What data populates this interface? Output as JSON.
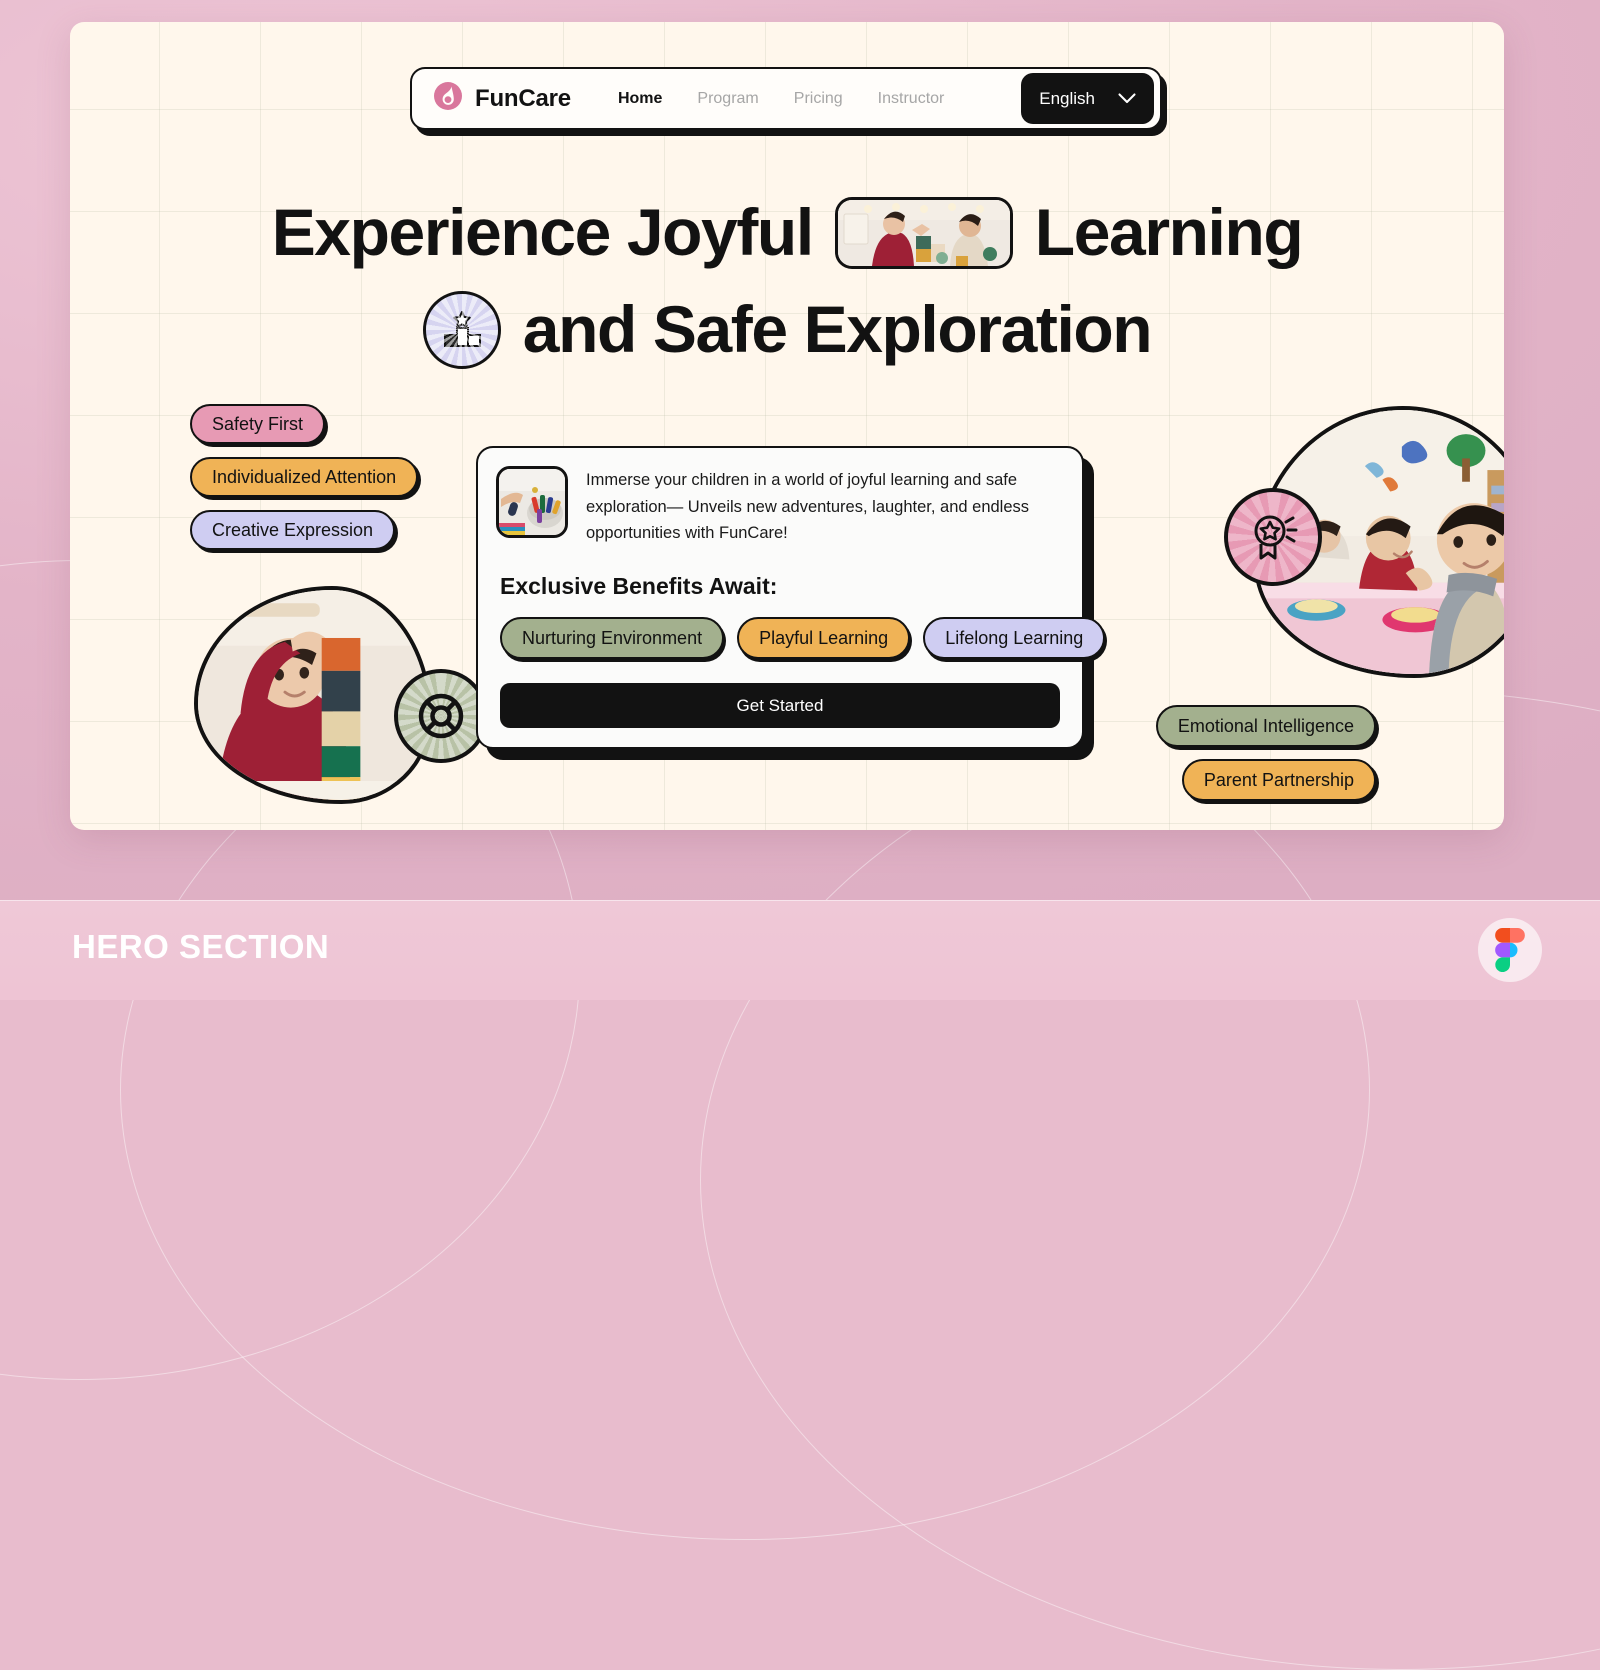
{
  "caption": {
    "label": "HERO SECTION",
    "tool_icon": "figma-icon"
  },
  "navbar": {
    "logo_icon": "funcare-droplet-logo",
    "brand": "FunCare",
    "links": [
      {
        "label": "Home",
        "active": true
      },
      {
        "label": "Program",
        "active": false
      },
      {
        "label": "Pricing",
        "active": false
      },
      {
        "label": "Instructor",
        "active": false
      }
    ],
    "language": {
      "label": "English",
      "chevron_icon": "chevron-down-icon"
    }
  },
  "headline": {
    "line1_before": "Experience Joyful",
    "line1_after": "Learning",
    "line2": "and Safe Exploration",
    "inline_photo_alt": "two-children-playing-blocks",
    "inline_badge_icon": "podium-star-icon"
  },
  "left_chips": [
    {
      "label": "Safety First",
      "color": "#e79ab4"
    },
    {
      "label": "Individualized Attention",
      "color": "#f0b356"
    },
    {
      "label": "Creative Expression",
      "color": "#cfcdf2"
    }
  ],
  "right_chips": [
    {
      "label": "Emotional Intelligence",
      "color": "#a3b08e"
    },
    {
      "label": "Parent Partnership",
      "color": "#f0b356"
    }
  ],
  "offer_card": {
    "thumb_alt": "child-hand-with-crayons",
    "description": "Immerse your children in a world of joyful learning and safe exploration— Unveils new adventures, laughter, and endless opportunities with FunCare!",
    "benefits_title": "Exclusive Benefits Await:",
    "benefit_chips": [
      {
        "label": "Nurturing Environment",
        "color": "#a3b08e"
      },
      {
        "label": "Playful Learning",
        "color": "#f0b356"
      },
      {
        "label": "Lifelong Learning",
        "color": "#cfcdf2"
      }
    ],
    "cta": "Get Started"
  },
  "photos": {
    "left_blob_alt": "toddler-stacking-colored-blocks",
    "left_blob_icon": "lifebuoy-icon",
    "right_blob_alt": "children-at-classroom-table-waving",
    "right_blob_icon": "award-ribbon-star-icon"
  },
  "colors": {
    "canvas": "#fff7ec",
    "ink": "#121212",
    "page_pink": "#e3b4c8",
    "brand_pink": "#d9779c"
  }
}
